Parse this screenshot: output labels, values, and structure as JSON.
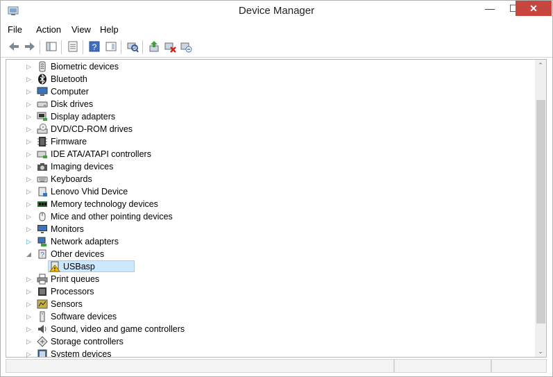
{
  "window": {
    "title": "Device Manager",
    "min_glyph": "—",
    "max_glyph": "☐",
    "close_glyph": "✕"
  },
  "menu": [
    {
      "label": "File"
    },
    {
      "label": "Action"
    },
    {
      "label": "View"
    },
    {
      "label": "Help"
    }
  ],
  "toolbar": {
    "icons": [
      "back-icon",
      "forward-icon",
      "show-hide-console-tree-icon",
      "properties-icon",
      "help-icon",
      "show-action-pane-icon",
      "scan-hardware-icon",
      "update-driver-icon",
      "disable-device-icon",
      "uninstall-device-icon"
    ]
  },
  "tree": {
    "items": [
      {
        "label": "Biometric devices",
        "icon": "biometric-icon",
        "expander": "▷"
      },
      {
        "label": "Bluetooth",
        "icon": "bluetooth-icon",
        "expander": "▷"
      },
      {
        "label": "Computer",
        "icon": "computer-icon",
        "expander": "▷"
      },
      {
        "label": "Disk drives",
        "icon": "disk-drive-icon",
        "expander": "▷"
      },
      {
        "label": "Display adapters",
        "icon": "display-adapter-icon",
        "expander": "▷"
      },
      {
        "label": "DVD/CD-ROM drives",
        "icon": "dvd-drive-icon",
        "expander": "▷"
      },
      {
        "label": "Firmware",
        "icon": "firmware-icon",
        "expander": "▷"
      },
      {
        "label": "IDE ATA/ATAPI controllers",
        "icon": "ide-controller-icon",
        "expander": "▷"
      },
      {
        "label": "Imaging devices",
        "icon": "camera-icon",
        "expander": "▷"
      },
      {
        "label": "Keyboards",
        "icon": "keyboard-icon",
        "expander": "▷"
      },
      {
        "label": "Lenovo Vhid Device",
        "icon": "hid-device-icon",
        "expander": "▷"
      },
      {
        "label": "Memory technology devices",
        "icon": "memory-device-icon",
        "expander": "▷"
      },
      {
        "label": "Mice and other pointing devices",
        "icon": "mouse-icon",
        "expander": "▷"
      },
      {
        "label": "Monitors",
        "icon": "monitor-icon",
        "expander": "▷"
      },
      {
        "label": "Network adapters",
        "icon": "network-adapter-icon",
        "expander": "▷"
      },
      {
        "label": "Other devices",
        "icon": "unknown-device-icon",
        "expander": "◢"
      },
      {
        "label": "USBasp",
        "icon": "warning-device-icon",
        "expander": ""
      },
      {
        "label": "Print queues",
        "icon": "printer-icon",
        "expander": "▷"
      },
      {
        "label": "Processors",
        "icon": "processor-icon",
        "expander": "▷"
      },
      {
        "label": "Sensors",
        "icon": "sensor-icon",
        "expander": "▷"
      },
      {
        "label": "Software devices",
        "icon": "software-device-icon",
        "expander": "▷"
      },
      {
        "label": "Sound, video and game controllers",
        "icon": "speaker-icon",
        "expander": "▷"
      },
      {
        "label": "Storage controllers",
        "icon": "storage-controller-icon",
        "expander": "▷"
      },
      {
        "label": "System devices",
        "icon": "system-device-icon",
        "expander": "▷"
      }
    ]
  },
  "scrollbar": {
    "up_glyph": "⌃",
    "down_glyph": "⌄"
  },
  "colors": {
    "selection_bg": "#cce8ff",
    "close_button": "#c7463e",
    "network_expander": "#2aa2d8"
  }
}
